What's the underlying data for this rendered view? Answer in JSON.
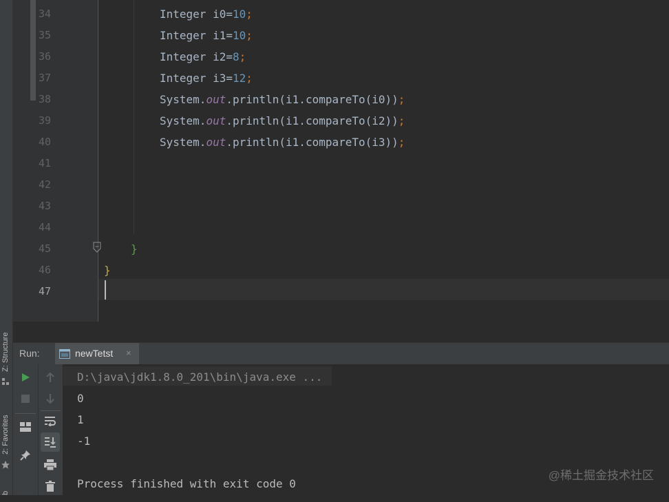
{
  "side_tabs": {
    "structure": "Z: Structure",
    "favorites": "2: Favorites",
    "bottom_stub": "b"
  },
  "editor": {
    "lines": [
      {
        "num": "34",
        "text": "Integer i0=",
        "value": "10",
        "end": ";"
      },
      {
        "num": "35",
        "text": "Integer i1=",
        "value": "10",
        "end": ";"
      },
      {
        "num": "36",
        "text": "Integer i2=",
        "value": "8",
        "end": ";"
      },
      {
        "num": "37",
        "text": "Integer i3=",
        "value": "12",
        "end": ";"
      },
      {
        "num": "38",
        "pre": "System.",
        "field": "out",
        "mid": ".println(i1.compareTo(i0))",
        "end": ";"
      },
      {
        "num": "39",
        "pre": "System.",
        "field": "out",
        "mid": ".println(i1.compareTo(i2))",
        "end": ";"
      },
      {
        "num": "40",
        "pre": "System.",
        "field": "out",
        "mid": ".println(i1.compareTo(i3))",
        "end": ";"
      },
      {
        "num": "41"
      },
      {
        "num": "42"
      },
      {
        "num": "43"
      },
      {
        "num": "44"
      },
      {
        "num": "45",
        "brace": "}"
      },
      {
        "num": "46",
        "brace": "}"
      },
      {
        "num": "47"
      }
    ]
  },
  "run_panel": {
    "label": "Run:",
    "tab_label": "newTetst",
    "tab_close": "×",
    "console": {
      "command": "D:\\java\\jdk1.8.0_201\\bin\\java.exe ...",
      "outputs": [
        "0",
        "1",
        "-1"
      ],
      "exit_message": "Process finished with exit code 0"
    }
  },
  "watermark": "@稀土掘金技术社区",
  "colors": {
    "background": "#2b2b2b",
    "run_green": "#499c54",
    "number": "#6897bb",
    "keyword_orange": "#cc7832",
    "field_purple": "#9876aa"
  }
}
